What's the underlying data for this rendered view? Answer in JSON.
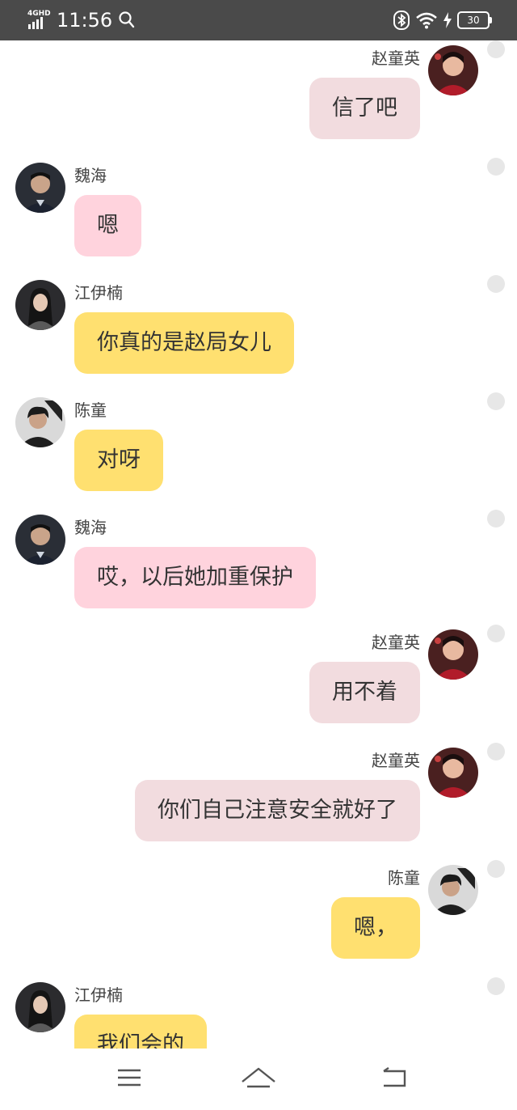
{
  "status_bar": {
    "network": "4GHD",
    "time": "11:56",
    "battery": "30",
    "icons": [
      "search-icon",
      "bluetooth-icon",
      "wifi-icon",
      "charging-icon",
      "battery-icon"
    ]
  },
  "messages": [
    {
      "side": "right",
      "sender": "赵童英",
      "text": "信了吧",
      "style": "rose",
      "avatar": "zhao-tongying"
    },
    {
      "side": "left",
      "sender": "魏海",
      "text": "嗯",
      "style": "pink",
      "avatar": "wei-hai"
    },
    {
      "side": "left",
      "sender": "江伊楠",
      "text": "你真的是赵局女儿",
      "style": "yellow",
      "avatar": "jiang-yinan"
    },
    {
      "side": "left",
      "sender": "陈童",
      "text": "对呀",
      "style": "yellow",
      "avatar": "chen-tong"
    },
    {
      "side": "left",
      "sender": "魏海",
      "text": "哎，以后她加重保护",
      "style": "pink",
      "avatar": "wei-hai"
    },
    {
      "side": "right",
      "sender": "赵童英",
      "text": "用不着",
      "style": "rose",
      "avatar": "zhao-tongying"
    },
    {
      "side": "right",
      "sender": "赵童英",
      "text": "你们自己注意安全就好了",
      "style": "rose",
      "avatar": "zhao-tongying"
    },
    {
      "side": "right",
      "sender": "陈童",
      "text": "嗯，",
      "style": "yellow",
      "avatar": "chen-tong"
    },
    {
      "side": "left",
      "sender": "江伊楠",
      "text": "我们会的",
      "style": "yellow",
      "avatar": "jiang-yinan"
    }
  ],
  "nav_bar": {
    "buttons": [
      "menu-icon",
      "home-icon",
      "back-icon"
    ]
  }
}
